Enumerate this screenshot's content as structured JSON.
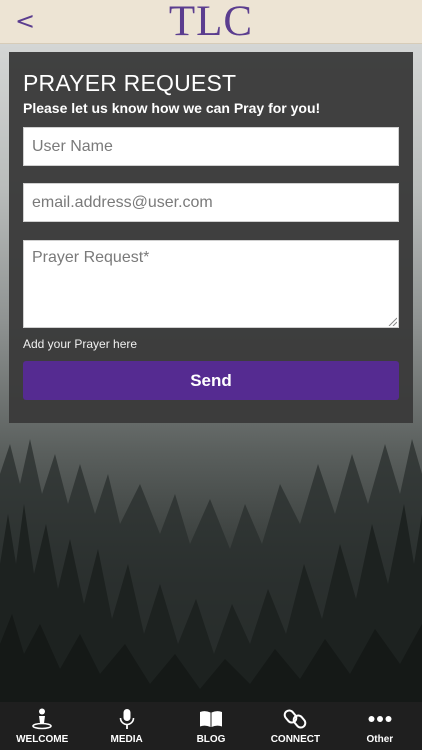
{
  "header": {
    "back_icon": "chevron-left-icon",
    "back_glyph": "<",
    "logo_text": "TLC",
    "accent_color": "#5b3d8f"
  },
  "form": {
    "title": "PRAYER REQUEST",
    "subtitle": "Please let us know how we can Pray for you!",
    "name_placeholder": "User Name",
    "email_placeholder": "email.address@user.com",
    "prayer_placeholder": "Prayer Request*",
    "hint": "Add your Prayer here",
    "send_label": "Send",
    "button_color": "#552b91"
  },
  "nav": {
    "items": [
      {
        "label": "WELCOME",
        "icon": "person-icon"
      },
      {
        "label": "MEDIA",
        "icon": "microphone-icon"
      },
      {
        "label": "BLOG",
        "icon": "book-icon"
      },
      {
        "label": "CONNECT",
        "icon": "link-icon"
      },
      {
        "label": "Other",
        "icon": "more-dots-icon"
      }
    ]
  }
}
